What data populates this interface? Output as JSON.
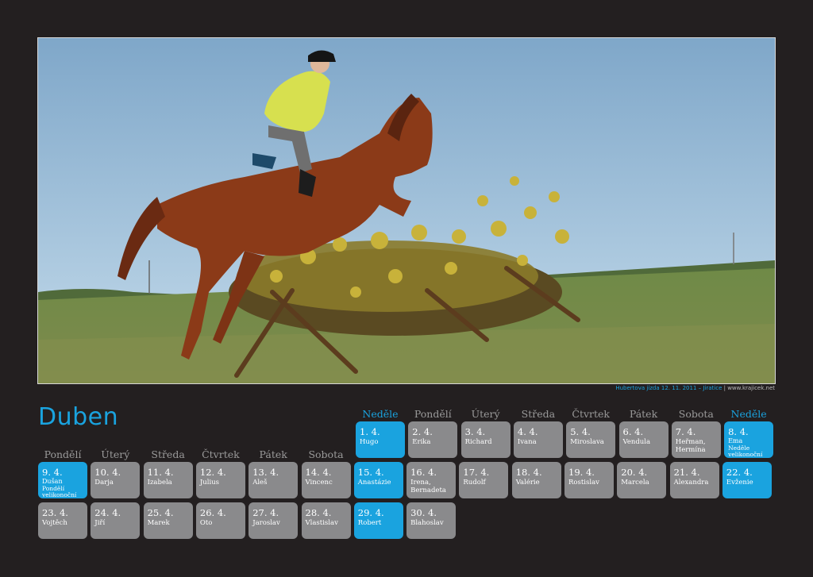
{
  "photo": {
    "description_icon": "photo-horse-jump",
    "credit_event": "Hubertova jízda 12. 11. 2011 – Jiratice",
    "credit_site": " | www.krajicek.net"
  },
  "month": "Duben",
  "colors": {
    "accent": "#1aa3df",
    "cell": "#8a8a8c",
    "background": "#231f20"
  },
  "row0_headers": [
    "Neděle",
    "Pondělí",
    "Úterý",
    "Středa",
    "Čtvrtek",
    "Pátek",
    "Sobota",
    "Neděle"
  ],
  "row1_headers": [
    "Pondělí",
    "Úterý",
    "Středa",
    "Čtvrtek",
    "Pátek",
    "Sobota"
  ],
  "days": [
    {
      "date": "1. 4.",
      "name": "Hugo",
      "sun": true
    },
    {
      "date": "2. 4.",
      "name": "Erika"
    },
    {
      "date": "3. 4.",
      "name": "Richard"
    },
    {
      "date": "4. 4.",
      "name": "Ivana"
    },
    {
      "date": "5. 4.",
      "name": "Miroslava"
    },
    {
      "date": "6. 4.",
      "name": "Vendula"
    },
    {
      "date": "7. 4.",
      "name": "Heřman,",
      "name2": "Hermína"
    },
    {
      "date": "8. 4.",
      "name": "Ema",
      "extra": "Neděle",
      "extra2": "velikonoční",
      "sun": true
    },
    {
      "date": "9. 4.",
      "name": "Dušan",
      "extra": "Pondělí",
      "extra2": "velikonoční",
      "sun": true
    },
    {
      "date": "10. 4.",
      "name": "Darja"
    },
    {
      "date": "11. 4.",
      "name": "Izabela"
    },
    {
      "date": "12. 4.",
      "name": "Julius"
    },
    {
      "date": "13. 4.",
      "name": "Aleš"
    },
    {
      "date": "14. 4.",
      "name": "Vincenc"
    },
    {
      "date": "15. 4.",
      "name": "Anastázie",
      "sun": true
    },
    {
      "date": "16. 4.",
      "name": "Irena,",
      "name2": "Bernadeta"
    },
    {
      "date": "17. 4.",
      "name": "Rudolf"
    },
    {
      "date": "18. 4.",
      "name": "Valérie"
    },
    {
      "date": "19. 4.",
      "name": "Rostislav"
    },
    {
      "date": "20. 4.",
      "name": "Marcela"
    },
    {
      "date": "21. 4.",
      "name": "Alexandra"
    },
    {
      "date": "22. 4.",
      "name": "Evženie",
      "sun": true
    },
    {
      "date": "23. 4.",
      "name": "Vojtěch"
    },
    {
      "date": "24. 4.",
      "name": "Jiří"
    },
    {
      "date": "25. 4.",
      "name": "Marek"
    },
    {
      "date": "26. 4.",
      "name": "Oto"
    },
    {
      "date": "27. 4.",
      "name": "Jaroslav"
    },
    {
      "date": "28. 4.",
      "name": "Vlastislav"
    },
    {
      "date": "29. 4.",
      "name": "Robert",
      "sun": true
    },
    {
      "date": "30. 4.",
      "name": "Blahoslav"
    }
  ]
}
